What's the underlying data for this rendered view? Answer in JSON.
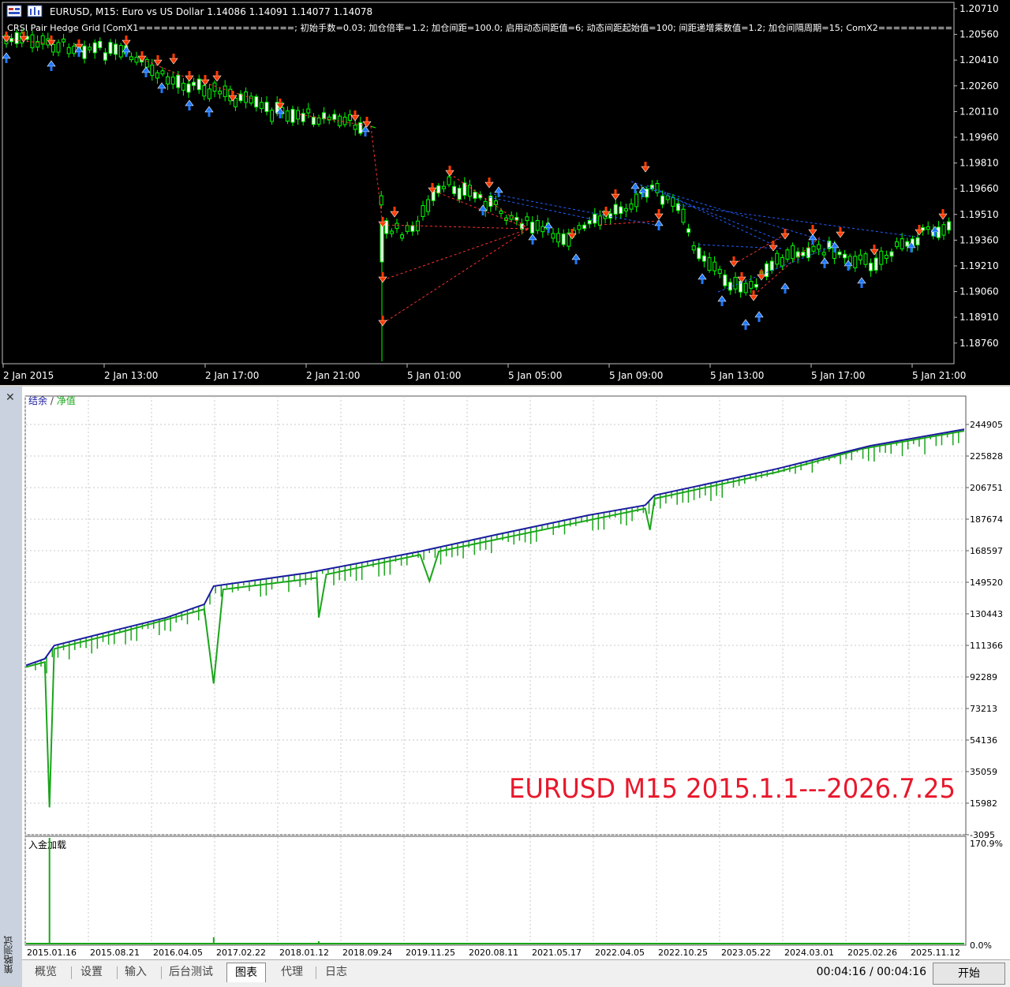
{
  "price_chart": {
    "title": "EURUSD, M15:  Euro vs US Dollar  1.14086 1.14091 1.14077 1.14078",
    "ea_params": "CRSI Pair Hedge Grid [ComX1=====================; 初始手数=0.03; 加仓倍率=1.2; 加仓间距=100.0; 启用动态间距值=6; 动态间距起始值=100; 间距递增乘数值=1.2; 加仓间隔周期=15; ComX2==========",
    "y_ticks": [
      "1.20710",
      "1.20560",
      "1.20410",
      "1.20260",
      "1.20110",
      "1.19960",
      "1.19810",
      "1.19660",
      "1.19510",
      "1.19360",
      "1.19210",
      "1.19060",
      "1.18910",
      "1.18760"
    ],
    "x_ticks": [
      "2 Jan 2015",
      "2 Jan 13:00",
      "2 Jan 17:00",
      "2 Jan 21:00",
      "5 Jan 01:00",
      "5 Jan 05:00",
      "5 Jan 09:00",
      "5 Jan 13:00",
      "5 Jan 17:00",
      "5 Jan 21:00"
    ],
    "colors": {
      "background": "#000000",
      "up_candle": "#ffffff",
      "down_candle": "#000000",
      "wick": "#00ff00",
      "sell_arrow": "#ff3b00",
      "buy_arrow": "#1e78ff",
      "grid_line_sell": "#ff3030",
      "grid_line_buy": "#2060ff"
    }
  },
  "tester": {
    "close_icon": "✕",
    "side_label": "策略测试",
    "legend_balance": "结余",
    "legend_sep": " / ",
    "legend_equity": "净值",
    "annotation": "EURUSD M15 2015.1.1---2026.7.25",
    "deposit_label": "入金加载",
    "deposit_ticks": [
      "170.9%",
      "0.0%"
    ],
    "y_ticks": [
      "244905",
      "225828",
      "206751",
      "187674",
      "168597",
      "149520",
      "130443",
      "111366",
      "92289",
      "73213",
      "54136",
      "35059",
      "15982",
      "-3095"
    ],
    "x_ticks": [
      "2015.01.16",
      "2015.08.21",
      "2016.04.05",
      "2017.02.22",
      "2018.01.12",
      "2018.09.24",
      "2019.11.25",
      "2020.08.11",
      "2021.05.17",
      "2022.04.05",
      "2022.10.25",
      "2023.05.22",
      "2024.03.01",
      "2025.02.26",
      "2025.11.12"
    ],
    "colors": {
      "balance": "#1c1ca0",
      "equity": "#1aa51a",
      "deposit": "#1aa51a",
      "annotation": "#e8182c"
    },
    "chart_data": {
      "type": "line",
      "title": "",
      "xlabel": "",
      "ylabel": "",
      "x_range": [
        "2015.01.01",
        "2026.07.25"
      ],
      "ylim": [
        -3095,
        244905
      ],
      "series": [
        {
          "name": "结余",
          "values": [
            [
              0,
              99000
            ],
            [
              0.02,
              103000
            ],
            [
              0.03,
              111000
            ],
            [
              0.1,
              121000
            ],
            [
              0.15,
              128000
            ],
            [
              0.19,
              136000
            ],
            [
              0.2,
              147000
            ],
            [
              0.3,
              155000
            ],
            [
              0.42,
              168000
            ],
            [
              0.5,
              178000
            ],
            [
              0.6,
              190000
            ],
            [
              0.66,
              196000
            ],
            [
              0.67,
              202000
            ],
            [
              0.8,
              218000
            ],
            [
              0.9,
              232000
            ],
            [
              1.0,
              242000
            ]
          ]
        },
        {
          "name": "净值",
          "values": [
            [
              0,
              98000
            ],
            [
              0.02,
              101000
            ],
            [
              0.025,
              13000
            ],
            [
              0.03,
              109000
            ],
            [
              0.1,
              119000
            ],
            [
              0.19,
              133000
            ],
            [
              0.2,
              88000
            ],
            [
              0.21,
              145000
            ],
            [
              0.31,
              152000
            ],
            [
              0.312,
              128000
            ],
            [
              0.32,
              154000
            ],
            [
              0.42,
              166000
            ],
            [
              0.43,
              150000
            ],
            [
              0.44,
              168000
            ],
            [
              0.66,
              194000
            ],
            [
              0.665,
              181000
            ],
            [
              0.67,
              200000
            ],
            [
              0.8,
              216000
            ],
            [
              0.89,
              230000
            ],
            [
              1.0,
              241000
            ]
          ]
        }
      ]
    }
  },
  "bottom_tabs": [
    "概览",
    "设置",
    "输入",
    "后台测试",
    "图表",
    "代理",
    "日志"
  ],
  "active_tab": "图表",
  "timer": "00:04:16 / 00:04:16",
  "start_button": "开始"
}
